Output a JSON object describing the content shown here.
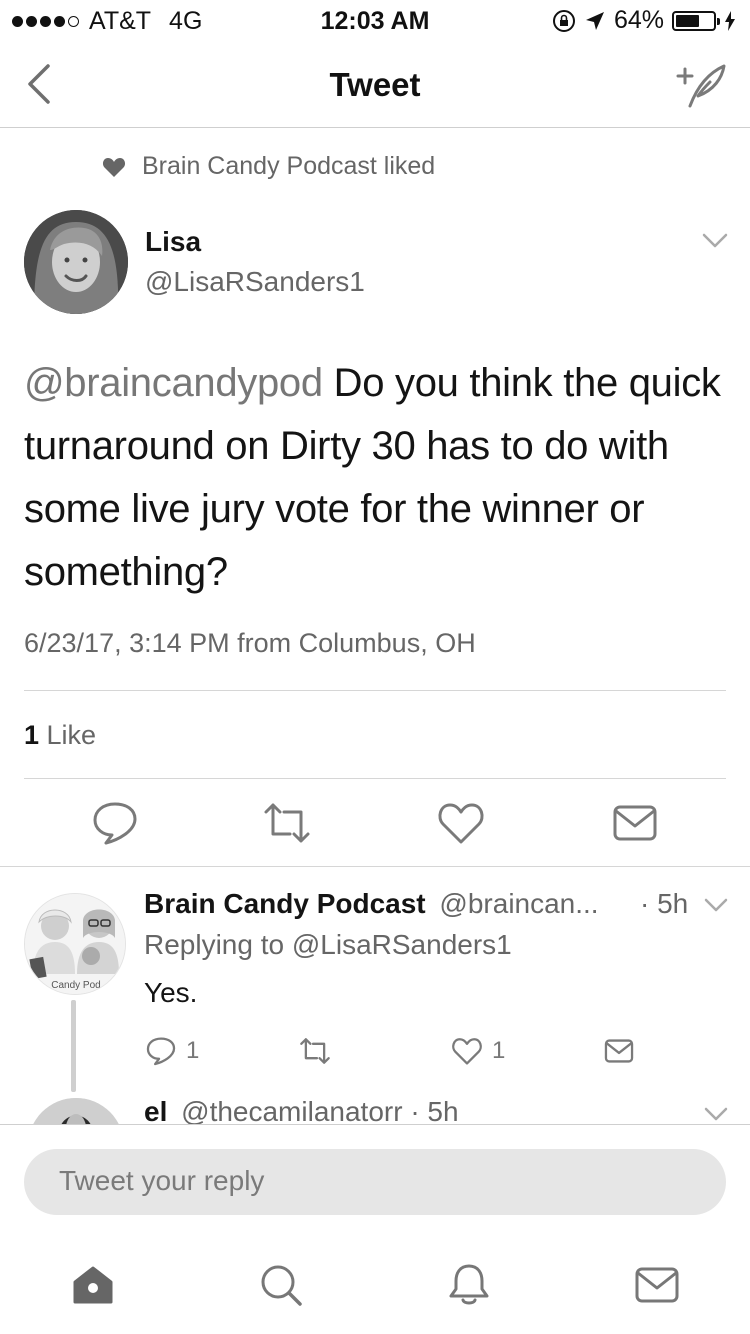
{
  "status_bar": {
    "carrier": "AT&T",
    "network": "4G",
    "time": "12:03 AM",
    "battery": "64%",
    "battery_level": 0.64,
    "signal_bars_filled": 4,
    "signal_bars_total": 5
  },
  "nav": {
    "title": "Tweet",
    "back_icon": "chevron-left-icon",
    "compose_icon": "compose-tweet-icon"
  },
  "context": {
    "liked_by": "Brain Candy Podcast liked",
    "icon": "heart-icon"
  },
  "tweet": {
    "author_name": "Lisa",
    "author_handle": "@LisaRSanders1",
    "mention": "@braincandypod",
    "text": " Do you think the quick turnaround on Dirty 30 has to do with some live jury vote for the winner or something?",
    "meta": "6/23/17, 3:14 PM from Columbus, OH",
    "like_count": "1",
    "like_label": " Like",
    "actions": [
      "reply-icon",
      "retweet-icon",
      "like-icon",
      "direct-message-icon"
    ]
  },
  "reply": {
    "name": "Brain Candy Podcast",
    "handle": "@braincan...",
    "time": "· 5h",
    "replying_to": "Replying to @LisaRSanders1",
    "text": "Yes.",
    "avatar_caption": "Candy Pod",
    "reply_count": "1",
    "like_count": "1"
  },
  "next_reply": {
    "name": "el",
    "handle": "@thecamilanatorr · 5h"
  },
  "composer": {
    "placeholder": "Tweet your reply"
  },
  "tabs": [
    "home-icon",
    "search-icon",
    "notifications-icon",
    "messages-icon"
  ]
}
